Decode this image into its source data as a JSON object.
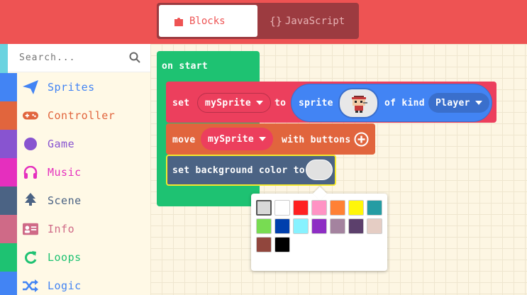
{
  "header": {
    "tab_blocks": "Blocks",
    "tab_js_braces": "{}",
    "tab_js": "JavaScript",
    "color": "#ee5353"
  },
  "search": {
    "placeholder": "Search..."
  },
  "categories": [
    {
      "label": "Sprites",
      "color": "#4284f4",
      "icon": "paper-plane-icon"
    },
    {
      "label": "Controller",
      "color": "#e1653d",
      "icon": "gamepad-icon"
    },
    {
      "label": "Game",
      "color": "#8854d0",
      "icon": "circle-icon"
    },
    {
      "label": "Music",
      "color": "#e52fbe",
      "icon": "headphones-icon"
    },
    {
      "label": "Scene",
      "color": "#4b6384",
      "icon": "tree-icon"
    },
    {
      "label": "Info",
      "color": "#cf6a87",
      "icon": "id-card-icon"
    },
    {
      "label": "Loops",
      "color": "#1ec272",
      "icon": "refresh-icon"
    },
    {
      "label": "Logic",
      "color": "#4284f4",
      "icon": "shuffle-icon"
    }
  ],
  "blocks": {
    "on_start": "on start",
    "set": "set",
    "set_var": "mySprite",
    "to": "to",
    "sprite": "sprite",
    "of_kind": "of kind",
    "kind": "Player",
    "move": "move",
    "move_var": "mySprite",
    "with_buttons": "with buttons",
    "set_bg": "set background color to"
  },
  "palette": [
    "#d8d8d8",
    "#ffffff",
    "#ff2121",
    "#ff93c4",
    "#ff8135",
    "#fff609",
    "#249ca3",
    "#78dc52",
    "#003fad",
    "#87f2ff",
    "#8e2ec4",
    "#a4839f",
    "#5c406c",
    "#e5cdc4",
    "#91463d",
    "#000000"
  ]
}
